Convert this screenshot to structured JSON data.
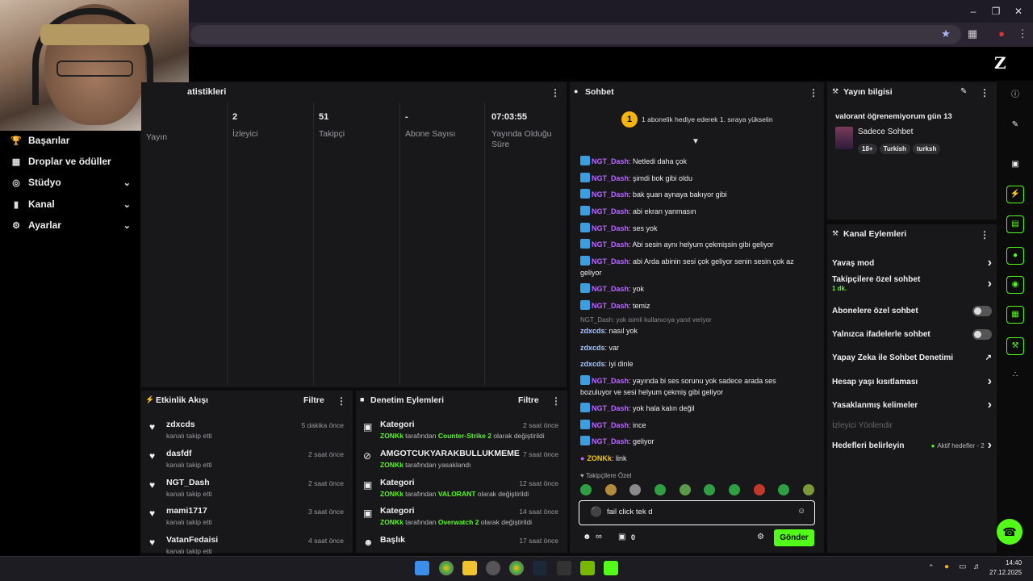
{
  "stats": {
    "title": "atistikleri",
    "columns": [
      {
        "value": "",
        "label": "Yayın"
      },
      {
        "value": "2",
        "label": "İzleyici"
      },
      {
        "value": "51",
        "label": "Takipçi"
      },
      {
        "value": "-",
        "label": "Abone Sayısı"
      },
      {
        "value": "07:03:55",
        "label": "Yayında Olduğu Süre"
      }
    ]
  },
  "sidebar": {
    "items": [
      {
        "label": "Başarılar",
        "icon": "trophy-icon"
      },
      {
        "label": "Droplar ve ödüller",
        "icon": "grid-icon"
      },
      {
        "label": "Stüdyo",
        "icon": "studio-icon",
        "expand": true
      },
      {
        "label": "Kanal",
        "icon": "channel-icon",
        "expand": true
      },
      {
        "label": "Ayarlar",
        "icon": "gear-icon",
        "expand": true
      }
    ]
  },
  "activity": {
    "title": "Etkinlik Akışı",
    "filter": "Filtre",
    "items": [
      {
        "name": "zdxcds",
        "sub": "kanalı takip etti",
        "time": "5 dakika önce"
      },
      {
        "name": "dasfdf",
        "sub": "kanalı takip etti",
        "time": "2 saat önce"
      },
      {
        "name": "NGT_Dash",
        "sub": "kanalı takip etti",
        "time": "2 saat önce"
      },
      {
        "name": "mami1717",
        "sub": "kanalı takip etti",
        "time": "3 saat önce"
      },
      {
        "name": "VatanFedaisi",
        "sub": "kanalı takip etti",
        "time": "4 saat önce"
      }
    ]
  },
  "moderation": {
    "title": "Denetim Eylemleri",
    "filter": "Filtre",
    "items": [
      {
        "name": "Kategori",
        "actor": "ZONKk",
        "pre": " tarafından ",
        "hl": "Counter-Strike 2",
        "post": " olarak değiştirildi",
        "time": "2 saat önce"
      },
      {
        "name": "AMGOTCUKYARAKBULLUKMEME",
        "actor": "ZONKk",
        "pre": " tarafından yasaklandı",
        "hl": "",
        "post": "",
        "time": "7 saat önce"
      },
      {
        "name": "Kategori",
        "actor": "ZONKk",
        "pre": " tarafından ",
        "hl": "VALORANT",
        "post": " olarak değiştirildi",
        "time": "12 saat önce"
      },
      {
        "name": "Kategori",
        "actor": "ZONKk",
        "pre": " tarafından ",
        "hl": "Overwatch 2",
        "post": " olarak değiştirildi",
        "time": "14 saat önce"
      },
      {
        "name": "Başlık",
        "actor": "",
        "pre": "",
        "hl": "",
        "post": "",
        "time": "17 saat önce"
      }
    ]
  },
  "chat": {
    "title": "Sohbet",
    "banner_rank": "1",
    "banner_text": "1 abonelik hediye ederek 1. sıraya yükselin",
    "messages": [
      {
        "user": "NGT_Dash",
        "text": ": Netledi daha çok"
      },
      {
        "user": "NGT_Dash",
        "text": ": şimdi bok gibi oldu"
      },
      {
        "user": "NGT_Dash",
        "text": ": bak şuan aynaya bakıyor gibi"
      },
      {
        "user": "NGT_Dash",
        "text": ": abi ekran yanmasın"
      },
      {
        "user": "NGT_Dash",
        "text": ": ses yok"
      },
      {
        "user": "NGT_Dash",
        "text": ": Abi sesin aynı helyum çekmişsin gibi geliyor"
      },
      {
        "user": "NGT_Dash",
        "text": ": abi Arda abinin sesi çok geliyor senin sesin çok az geliyor"
      },
      {
        "user": "NGT_Dash",
        "text": ": yok"
      },
      {
        "user": "NGT_Dash",
        "text": ": temiz"
      },
      {
        "user": "zdxcds",
        "text": ": nasıl yok"
      },
      {
        "user": "zdxcds",
        "text": ": var"
      },
      {
        "user": "zdxcds",
        "text": ": iyi dinle"
      },
      {
        "user": "NGT_Dash",
        "text": ": yayında bi ses sorunu yok sadece arada ses bozuluyor ve sesi helyum çekmiş gibi geliyor"
      },
      {
        "user": "NGT_Dash",
        "text": ": yok hala kalın değil"
      },
      {
        "user": "NGT_Dash",
        "text": ": ince"
      },
      {
        "user": "NGT_Dash",
        "text": ": geliyor"
      },
      {
        "user": "ZONKk",
        "text": ": link"
      }
    ],
    "reply_note": "NGT_Dash: yok isimli kullanıcıya yanıt veriyor",
    "followers_only": "Takipçilere Özel",
    "input_value": "fail click tek d",
    "points": "0",
    "send": "Gönder"
  },
  "stream_info": {
    "title": "Yayın bilgisi",
    "stream_title": "valorant öğrenemiyorum gün 13",
    "category": "Sadece Sohbet",
    "tags": [
      "18+",
      "Turkish",
      "turksh"
    ]
  },
  "channel_actions": {
    "title": "Kanal Eylemleri",
    "rows": [
      {
        "label": "Yavaş mod",
        "kind": "chevron",
        "sub": ""
      },
      {
        "label": "Takipçilere özel sohbet",
        "kind": "chevron",
        "sub": "1 dk."
      },
      {
        "label": "Abonelere özel sohbet",
        "kind": "toggle",
        "sub": ""
      },
      {
        "label": "Yalnızca ifadelerle sohbet",
        "kind": "toggle",
        "sub": ""
      },
      {
        "label": "Yapay Zeka ile Sohbet Denetimi",
        "kind": "external",
        "sub": ""
      },
      {
        "label": "Hesap yaşı kısıtlaması",
        "kind": "chevron",
        "sub": ""
      },
      {
        "label": "Yasaklanmış kelimeler",
        "kind": "chevron",
        "sub": ""
      },
      {
        "label": "İzleyici Yönlendir",
        "kind": "disabled",
        "sub": ""
      },
      {
        "label": "Hedefleri belirleyin",
        "kind": "goal",
        "sub": "Aktif hedefler - 2"
      }
    ]
  },
  "brand": {
    "logo": "Z",
    "accent": "#53fc18"
  },
  "clock": {
    "time": "14:40",
    "date": "27.12.2025"
  }
}
